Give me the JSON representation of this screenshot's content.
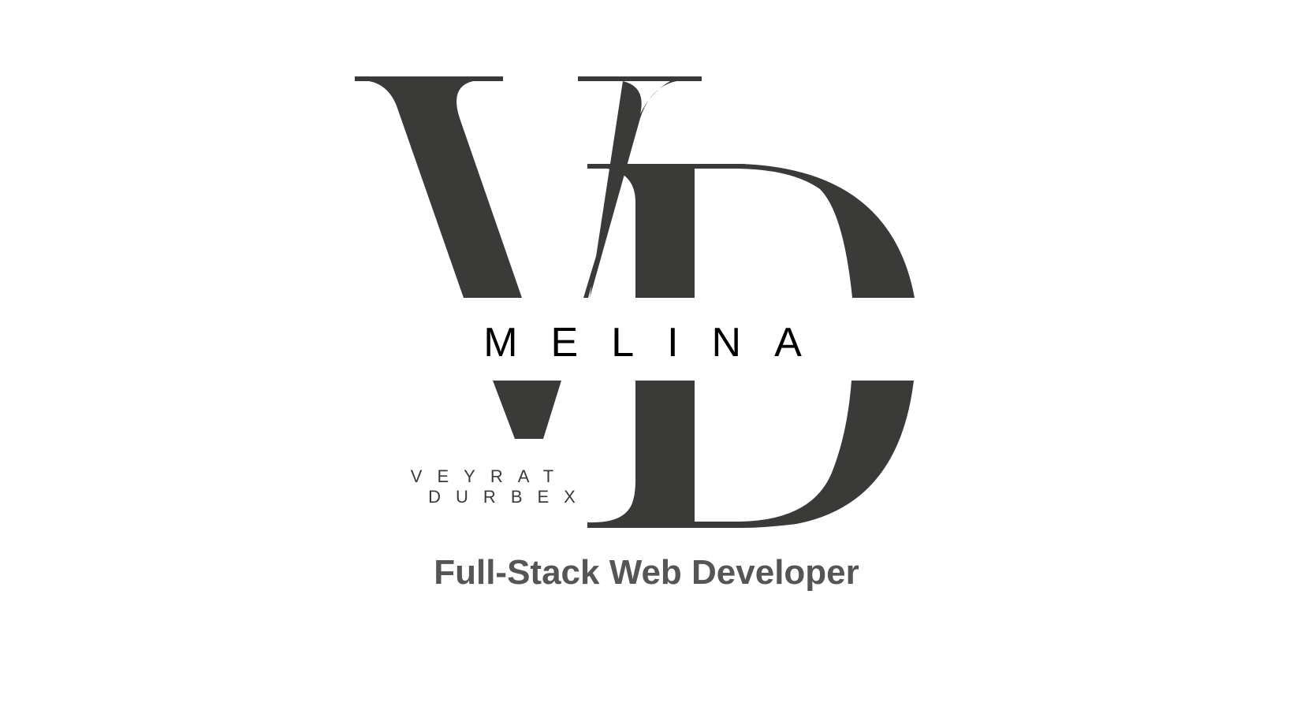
{
  "brand": {
    "first_name": "MELINA",
    "last_name_line1": "VEYRAT",
    "last_name_line2": "DURBEX",
    "monogram": "VD",
    "logo_color": "#3a3a38",
    "text_color": "#000000"
  },
  "tagline": "Full-Stack Web Developer",
  "colors": {
    "background": "#ffffff",
    "tagline": "#555555"
  }
}
